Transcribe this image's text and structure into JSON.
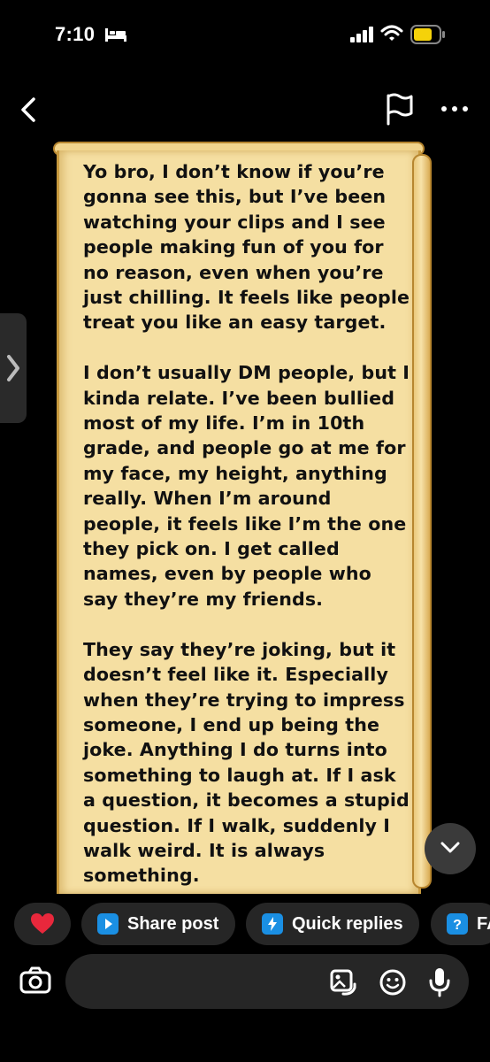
{
  "status_bar": {
    "time": "7:10",
    "icons": [
      "bed-icon",
      "signal-icon",
      "wifi-icon",
      "battery-icon"
    ],
    "battery_color": "#f5d20a"
  },
  "nav": {
    "back_icon": "chevron-left-icon",
    "flag_icon": "flag-icon",
    "more_icon": "more-horizontal-icon"
  },
  "message": {
    "paragraphs": [
      "Yo bro, I don’t know if you’re gonna see this, but I’ve been watching your clips and I see people making fun of you for no reason, even when you’re just chilling. It feels like people treat you like an easy target.",
      "I don’t usually DM people, but I kinda relate. I’ve been bullied most of my life. I’m in 10th grade, and people go at me for my face, my height, anything really. When I’m around people, it feels like I’m the one they pick on. I get called names, even by people who say they’re my friends.",
      "They say they’re joking, but it doesn’t feel like it. Especially when they’re trying to impress someone, I end up being the joke. Anything I do turns into something to laugh at. If I ask a question, it becomes a stupid question. If I walk, suddenly I walk weird. It is always something."
    ],
    "paper_color": "#f5dfa2"
  },
  "chips": {
    "heart_icon": "heart-icon",
    "share_label": "Share post",
    "quick_label": "Quick replies",
    "faq_label": "FA"
  },
  "composer": {
    "icons": [
      "camera-icon",
      "gallery-icon",
      "sticker-icon",
      "microphone-icon"
    ]
  },
  "colors": {
    "accent_blue": "#1a8fe3",
    "heart_red": "#e8283c",
    "chip_bg": "#262626"
  }
}
